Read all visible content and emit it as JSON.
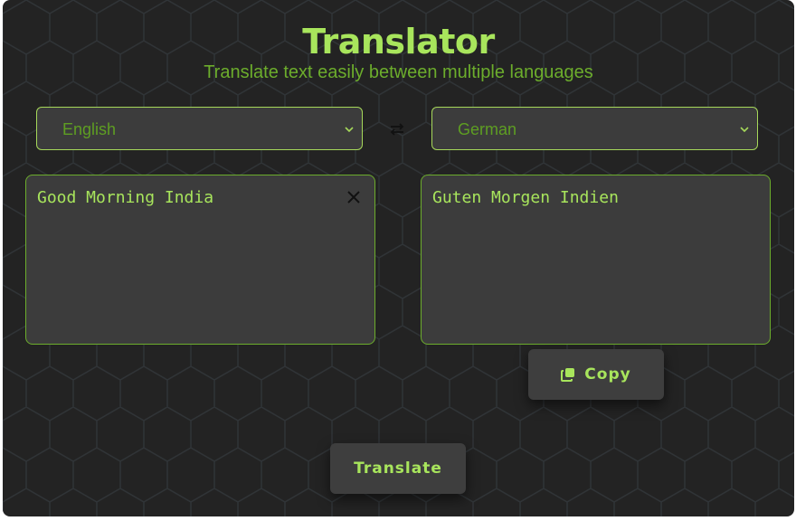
{
  "header": {
    "title": "Translator",
    "subtitle": "Translate text easily between multiple languages"
  },
  "source": {
    "language": "English",
    "text": "Good Morning India"
  },
  "target": {
    "language": "German",
    "text": "Guten Morgen Indien"
  },
  "actions": {
    "copy_label": "Copy",
    "translate_label": "Translate"
  },
  "icons": {
    "swap": "swap-arrows-icon",
    "clear": "close-icon",
    "copy": "copy-icon",
    "dropdown": "chevron-down-icon"
  },
  "colors": {
    "accent": "#a8e55c",
    "accent_dark": "#6cad2c",
    "background": "#232323",
    "panel": "#3c3c3c"
  }
}
